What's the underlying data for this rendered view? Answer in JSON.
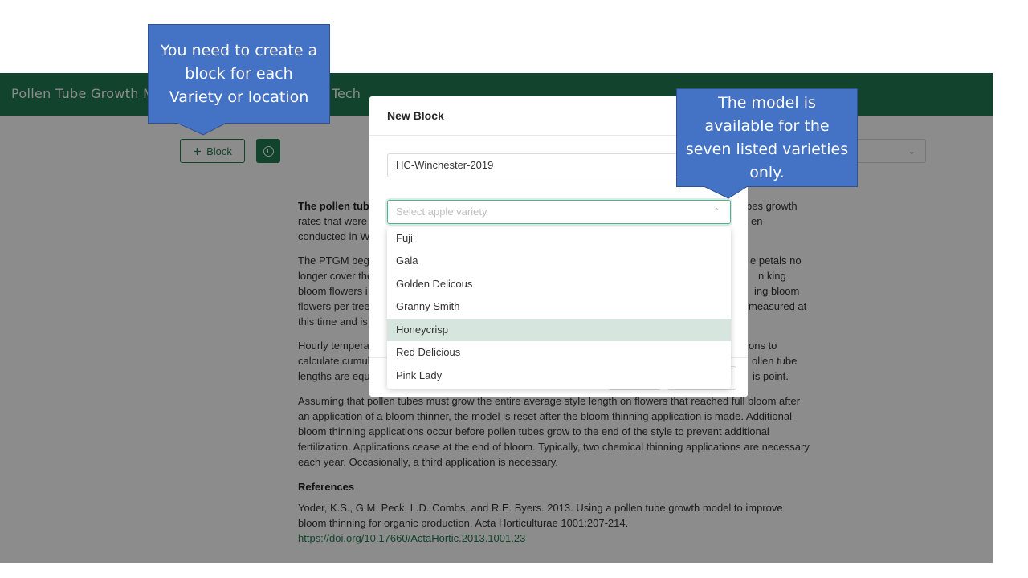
{
  "app": {
    "title": "Pollen Tube Growth M",
    "title_tail": "Tech",
    "brand_color": "#1f7a52"
  },
  "toolbar": {
    "block_button_label": "Block",
    "block_button_icon": "plus-icon",
    "info_button_icon": "info-icon"
  },
  "content": {
    "p1": [
      "The pollen tube",
      "bes growth",
      "rates that were",
      "en",
      "conducted in W"
    ],
    "p2": [
      "The PTGM begi",
      "e petals no",
      "longer cover the",
      "n king",
      "bloom flowers i",
      "ing bloom",
      "flowers per tree",
      "measured at",
      "this time and is"
    ],
    "p3": [
      "Hourly tempera",
      "ons to",
      "calculate cumul",
      "ollen tube",
      "lengths are equ",
      "is point."
    ],
    "p4": "Assuming that pollen tubes must grow the entire average style length on flowers that reached full bloom after an application of a bloom thinner, the model is reset after the bloom thinning application is made. Additional bloom thinning applications occur before pollen tubes grow to the end of the style to prevent additional fertilization. Applications cease at the end of bloom. Typically, two chemical thinning applications are necessary each year. Occasionally, a third application is necessary.",
    "references_heading": "References",
    "reference1": "Yoder, K.S., G.M. Peck, L.D. Combs, and R.E. Byers. 2013. Using a pollen tube growth model to improve bloom thinning for organic production. Acta Horticulturae 1001:207-214.",
    "reference1_link": "https://doi.org/10.17660/ActaHortic.2013.1001.23"
  },
  "modal": {
    "title": "New Block",
    "name_value": "HC-Winchester-2019",
    "variety_placeholder": "Select apple variety"
  },
  "dropdown": {
    "options": [
      "Fuji",
      "Gala",
      "Golden Delicous",
      "Granny Smith",
      "Honeycrisp",
      "Red Delicious",
      "Pink Lady"
    ],
    "highlighted": "Honeycrisp"
  },
  "callouts": {
    "left": [
      "You need to create a",
      "block for each",
      "Variety or location"
    ],
    "right": [
      "The model is",
      "available for the",
      "seven listed varieties",
      "only."
    ],
    "color": "#4472c4"
  }
}
